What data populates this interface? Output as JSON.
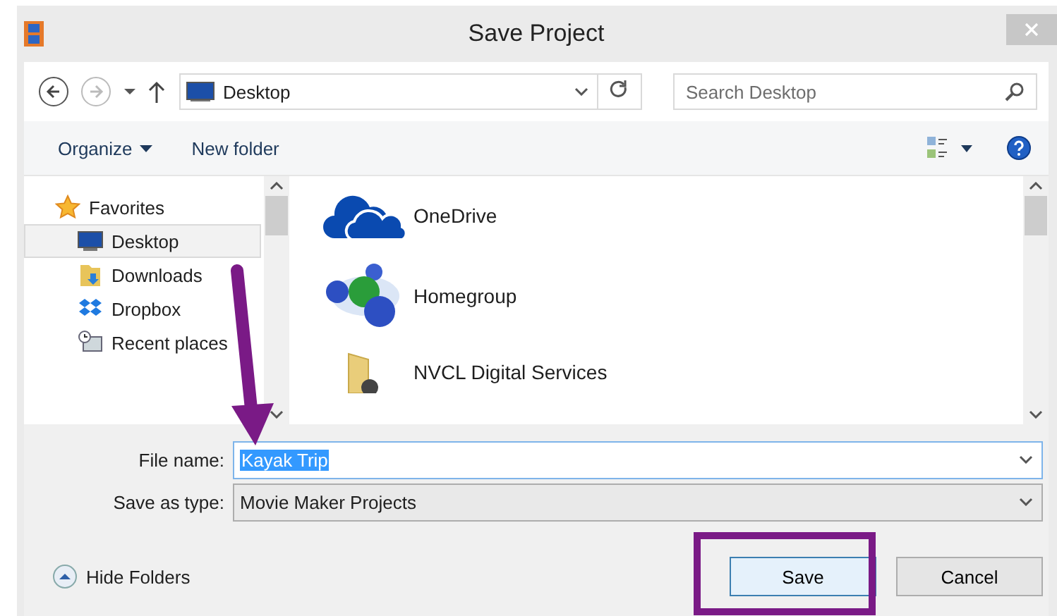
{
  "window": {
    "title": "Save Project"
  },
  "address": {
    "location": "Desktop"
  },
  "search": {
    "placeholder": "Search Desktop"
  },
  "toolbar": {
    "organize": "Organize",
    "new_folder": "New folder"
  },
  "nav": {
    "header": "Favorites",
    "items": [
      {
        "label": "Desktop",
        "kind": "desktop",
        "selected": true
      },
      {
        "label": "Downloads",
        "kind": "downloads",
        "selected": false
      },
      {
        "label": "Dropbox",
        "kind": "dropbox",
        "selected": false
      },
      {
        "label": "Recent places",
        "kind": "recent",
        "selected": false
      }
    ]
  },
  "files": [
    {
      "name": "OneDrive",
      "kind": "cloud"
    },
    {
      "name": "Homegroup",
      "kind": "homegroup"
    },
    {
      "name": "NVCL Digital Services",
      "kind": "folder"
    }
  ],
  "form": {
    "file_name_label": "File name:",
    "file_name": "Kayak Trip",
    "file_name_selected": true,
    "type_label": "Save as type:",
    "type": "Movie Maker Projects"
  },
  "hide_folders": "Hide Folders",
  "buttons": [
    {
      "label": "Save",
      "default": true
    },
    {
      "label": "Cancel",
      "default": false
    }
  ]
}
